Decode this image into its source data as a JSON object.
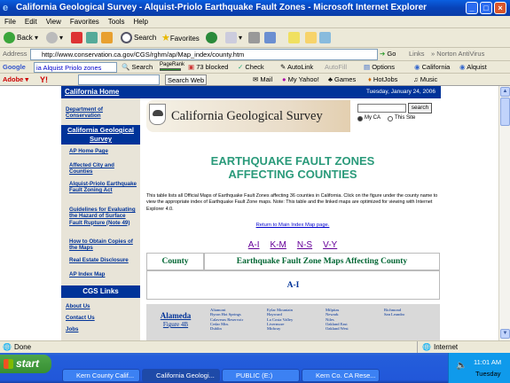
{
  "window": {
    "title": "California Geological Survey - Alquist-Priolo Earthquake Fault Zones - Microsoft Internet Explorer",
    "controls": [
      "_",
      "□",
      "×"
    ]
  },
  "menu": [
    "File",
    "Edit",
    "View",
    "Favorites",
    "Tools",
    "Help"
  ],
  "toolbar": {
    "back": "Back",
    "search": "Search",
    "favorites": "Favorites"
  },
  "address": {
    "label": "Address",
    "url": "http://www.conservation.ca.gov/CGS/rghm/ap/Map_index/county.htm",
    "go": "Go",
    "links": "Links",
    "norton": "Norton AntiVirus"
  },
  "google_bar": {
    "label": "Google",
    "query": "ia Alquist Priolo zones",
    "search": "Search",
    "pagerank": "PageRank",
    "blocked": "73 blocked",
    "check": "Check",
    "autolink": "AutoLink",
    "autofill": "AutoFill",
    "options": "Options",
    "california": "California",
    "alquist": "Alquist"
  },
  "yahoo_bar": {
    "adobe": "Adobe",
    "yahoo": "Y!",
    "search_web": "Search Web",
    "mail": "Mail",
    "my_yahoo": "My Yahoo!",
    "games": "Games",
    "hotjobs": "HotJobs",
    "music": "Music"
  },
  "page": {
    "home": "California Home",
    "date": "Tuesday, January 24, 2006",
    "site_title": "California Geological Survey",
    "search_button": "search",
    "radio_myca": "My CA",
    "radio_site": "This Site",
    "sidebar_top": "Department of Conservation",
    "sidebar_cgs": "California Geological Survey",
    "sidebar_links": [
      "AP Home Page",
      "Affected City and Counties",
      "Alquist-Priolo Earthquake Fault Zoning Act",
      "Guidelines for Evaluating the Hazard of Surface Fault Rupture (Note 49)",
      "How to Obtain Copies of the Maps",
      "Real Estate Disclosure",
      "AP Index Map"
    ],
    "cgs_links_title": "CGS Links",
    "cgs_links": [
      "About Us",
      "Contact Us",
      "Jobs"
    ],
    "heading_line1": "EARTHQUAKE FAULT ZONES",
    "heading_line2": "AFFECTING COUNTIES",
    "intro": "This table lists all Official Maps of Earthquake Fault Zones affecting 36 counties in California.  Click on the figure under the county name to view the appropriate index of Earthquake Fault Zone maps.  Note:  This table and the linked maps are optimized for viewing with Internet Explorer 4.0.",
    "return_link": "Return to Main Index Map page.",
    "letters": [
      "A-I",
      "K-M",
      "N-S",
      "V-Y"
    ],
    "table": {
      "col_county": "County",
      "col_maps": "Earthquake Fault Zone Maps Affecting County",
      "section": "A-I",
      "county": "Alameda",
      "figure": "Figure 4B",
      "maps": [
        [
          "Altamont",
          "Byron Hot Springs",
          "Calaveras Reservoir",
          "Cedar Mtn.",
          "Dublin"
        ],
        [
          "Eylar Mountain",
          "Hayward",
          "La Costa Valley",
          "Livermore",
          "Midway"
        ],
        [
          "Milpitas",
          "Newark",
          "Niles",
          "Oakland East",
          "Oakland West"
        ],
        [
          "Richmond",
          "San Leandro"
        ]
      ]
    }
  },
  "status": {
    "left": "Done",
    "zone": "Internet"
  },
  "taskbar": {
    "start": "start",
    "tasks": [
      "Kern County Calif...",
      "California Geologi...",
      "PUBLIC (E:)",
      "Kern Co. CA Rese..."
    ],
    "time": "11:01 AM",
    "day": "Tuesday"
  }
}
